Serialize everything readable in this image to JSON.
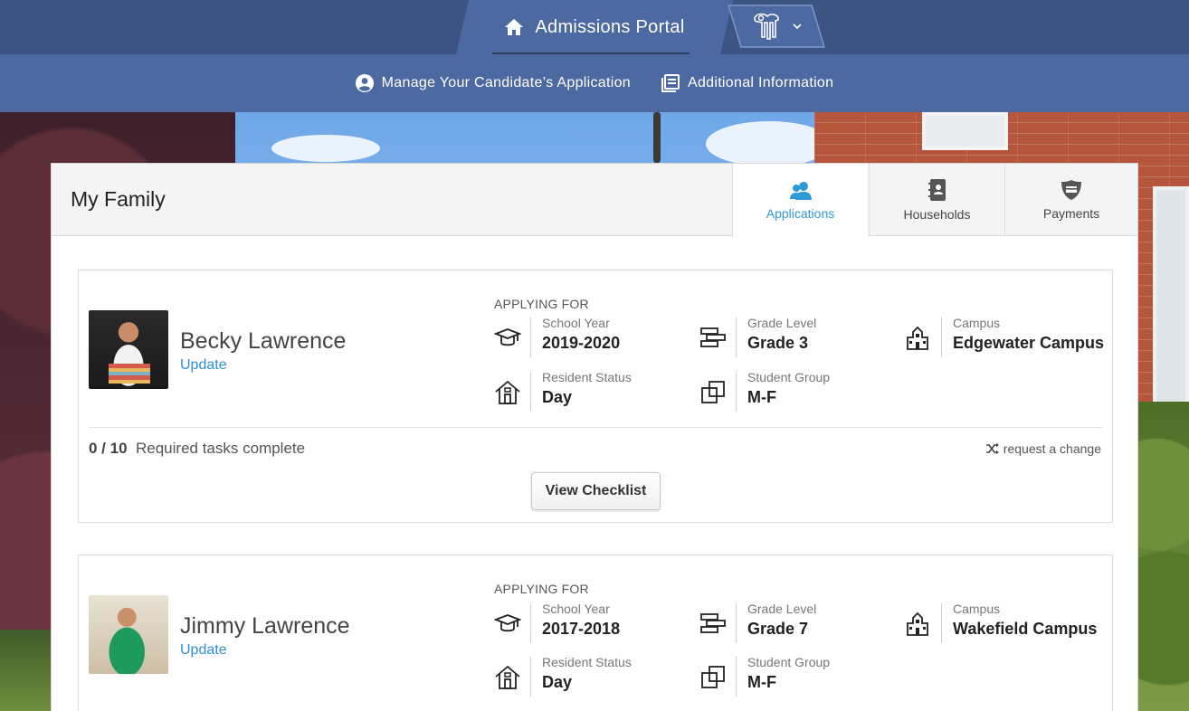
{
  "header": {
    "portal_title": "Admissions Portal",
    "nav": [
      {
        "label": "Manage Your Candidate’s Application",
        "icon": "account-circle-icon"
      },
      {
        "label": "Additional Information",
        "icon": "document-list-icon"
      }
    ]
  },
  "panel": {
    "title": "My Family",
    "tabs": [
      {
        "label": "Applications",
        "icon": "users-icon",
        "active": true
      },
      {
        "label": "Households",
        "icon": "address-book-icon",
        "active": false
      },
      {
        "label": "Payments",
        "icon": "payment-shield-icon",
        "active": false
      }
    ]
  },
  "candidates": [
    {
      "name": "Becky Lawrence",
      "update_label": "Update",
      "applying_for": "APPLYING FOR",
      "school_year_label": "School Year",
      "school_year": "2019-2020",
      "grade_label": "Grade Level",
      "grade": "Grade 3",
      "campus_label": "Campus",
      "campus": "Edgewater Campus",
      "resident_label": "Resident Status",
      "resident": "Day",
      "group_label": "Student Group",
      "group": "M-F",
      "tasks_done": "0 / 10",
      "tasks_text": "Required tasks complete",
      "request_change": "request a change",
      "checklist_button": "View Checklist"
    },
    {
      "name": "Jimmy Lawrence",
      "update_label": "Update",
      "applying_for": "APPLYING FOR",
      "school_year_label": "School Year",
      "school_year": "2017-2018",
      "grade_label": "Grade Level",
      "grade": "Grade 7",
      "campus_label": "Campus",
      "campus": "Wakefield Campus",
      "resident_label": "Resident Status",
      "resident": "Day",
      "group_label": "Student Group",
      "group": "M-F"
    }
  ],
  "colors": {
    "topbar": "#3c5483",
    "navbar": "#4d69a1",
    "accent": "#2e9ad6",
    "link": "#2e8fd3"
  }
}
